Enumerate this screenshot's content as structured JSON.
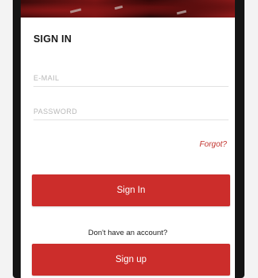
{
  "signin": {
    "title": "SIGN IN",
    "email_placeholder": "E-MAIL",
    "password_placeholder": "PASSWORD",
    "forgot_label": "Forgot?",
    "signin_button": "Sign In",
    "no_account_text": "Don't have an account?",
    "signup_button": "Sign up"
  },
  "colors": {
    "accent": "#cc2d2b",
    "forgot_link": "#c2342e",
    "hero_dark": "#3b0a0a",
    "hero_red": "#8d1a1a"
  }
}
